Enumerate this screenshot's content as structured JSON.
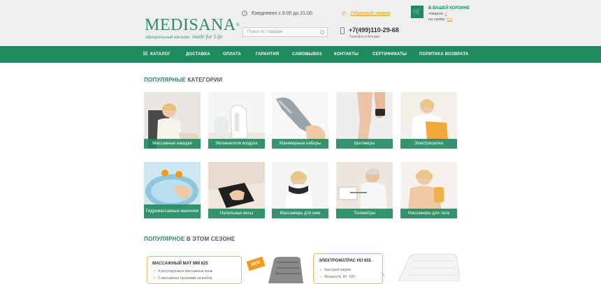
{
  "header": {
    "logo_name": "MEDISANA",
    "logo_reg": "®",
    "logo_sub": "официальный магазин",
    "logo_slogan": "made for Life",
    "hours": "Ежедневно с 9:00 до 21:00",
    "search_placeholder": "Поиск по товарам",
    "callback": "Обратный звонок",
    "phone": "+7(499)110-29-68",
    "phone_sub": "Телефон в Москве",
    "cart_title": "В ВАШЕЙ КОРЗИНЕ",
    "cart_items_label": "товаров:",
    "cart_items_value": "0",
    "cart_sum_label": "на сумму:",
    "cart_sum_value": "0 р"
  },
  "nav": [
    {
      "label": "КАТАЛОГ"
    },
    {
      "label": "ДОСТАВКА"
    },
    {
      "label": "ОПЛАТА"
    },
    {
      "label": "ГАРАНТИЯ"
    },
    {
      "label": "САМОВЫВОЗ"
    },
    {
      "label": "КОНТАКТЫ"
    },
    {
      "label": "СЕРТИФИКАТЫ"
    },
    {
      "label": "ПОЛИТИКА ВОЗВРАТА"
    }
  ],
  "categories_title": {
    "accent": "ПОПУЛЯРНЫЕ",
    "rest": " КАТЕГОРИИ"
  },
  "categories": [
    {
      "label": "Массажные накидки"
    },
    {
      "label": "Увлажнители воздуха"
    },
    {
      "label": "Маникюрные наборы"
    },
    {
      "label": "Шагомеры"
    },
    {
      "label": "Электрогрелки"
    },
    {
      "label": "Гидромассажные ванночки"
    },
    {
      "label": "Напольные весы"
    },
    {
      "label": "Массажеры для шеи"
    },
    {
      "label": "Тонометры"
    },
    {
      "label": "Массажеры для тела"
    }
  ],
  "season_title": {
    "accent": "ПОПУЛЯРНОЕ",
    "rest": " В ЭТОМ СЕЗОНЕ"
  },
  "promos": [
    {
      "title": "МАССАЖНЫЙ МАТ MM 825",
      "items": [
        "4 регулируемые массажные зоны",
        "5 массажных программ на выбор"
      ],
      "badge": "NEW"
    },
    {
      "title": "ЭЛЕКТРОМАТРАС HU 655",
      "items": [
        "Быстрый нагрев",
        "Мощность, Вт: 100"
      ]
    }
  ]
}
